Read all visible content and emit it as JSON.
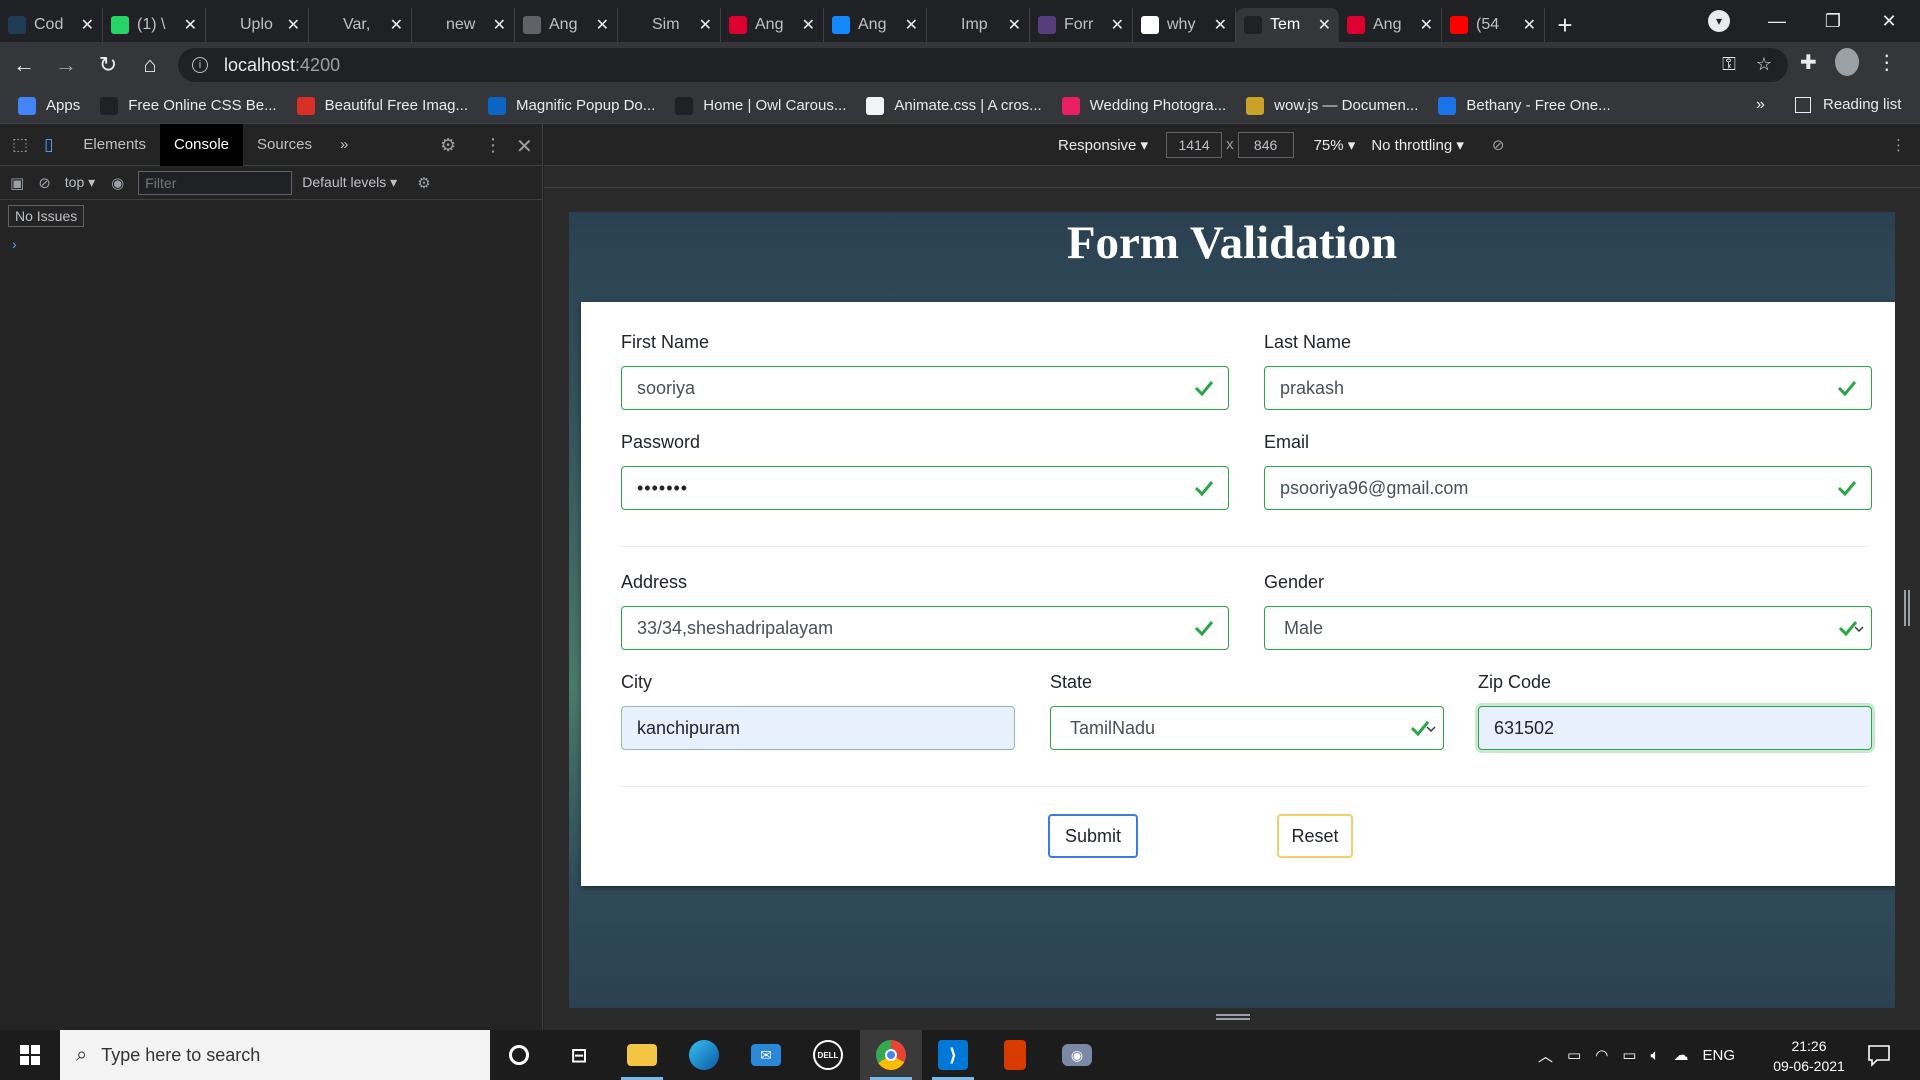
{
  "browser": {
    "tabs": [
      {
        "title": "Cod",
        "icon": "vscode-doc-icon",
        "color": "#1f3b57"
      },
      {
        "title": "(1) \\",
        "icon": "whatsapp-icon",
        "color": "#25d366"
      },
      {
        "title": "Uplo",
        "icon": "github-icon",
        "color": "#202124"
      },
      {
        "title": "Var,",
        "icon": "angular-a-icon",
        "color": "#202124"
      },
      {
        "title": "new",
        "icon": "dev-icon",
        "color": "#202124"
      },
      {
        "title": "Ang",
        "icon": "photo-icon",
        "color": "#5f6368"
      },
      {
        "title": "Sim",
        "icon": "openai-icon",
        "color": "#202124"
      },
      {
        "title": "Ang",
        "icon": "angular-icon",
        "color": "#dd0031"
      },
      {
        "title": "Ang",
        "icon": "bolt-icon",
        "color": "#1389fd"
      },
      {
        "title": "Imp",
        "icon": "medium-icon",
        "color": "#202124"
      },
      {
        "title": "Forr",
        "icon": "bootstrap-icon",
        "color": "#563d7c"
      },
      {
        "title": "why",
        "icon": "google-icon",
        "color": "#ffffff"
      },
      {
        "title": "Tem",
        "icon": "angular-tab-icon",
        "color": "#202124"
      },
      {
        "title": "Ang",
        "icon": "angular-icon",
        "color": "#dd0031"
      },
      {
        "title": "(54",
        "icon": "youtube-icon",
        "color": "#ff0000"
      }
    ],
    "url_host": "localhost",
    "url_port": ":4200",
    "bookmarks": [
      {
        "label": "Apps",
        "icon": "apps-grid-icon",
        "color": "#4285f4"
      },
      {
        "label": "Free Online CSS Be...",
        "icon": "ff-icon",
        "color": "#202124"
      },
      {
        "label": "Beautiful Free Imag...",
        "icon": "images-icon",
        "color": "#d93025"
      },
      {
        "label": "Magnific Popup Do...",
        "icon": "linkedin-icon",
        "color": "#0a66c2"
      },
      {
        "label": "Home | Owl Carous...",
        "icon": "owl-icon",
        "color": "#202124"
      },
      {
        "label": "Animate.css | A cros...",
        "icon": "animate-icon",
        "color": "#f1f3f4"
      },
      {
        "label": "Wedding Photogra...",
        "icon": "wedding-icon",
        "color": "#e91e63"
      },
      {
        "label": "wow.js — Documen...",
        "icon": "wowjs-icon",
        "color": "#c9a227"
      },
      {
        "label": "Bethany - Free One...",
        "icon": "bethany-icon",
        "color": "#1a73e8"
      }
    ],
    "bookmarks_more": "»",
    "reading_list": "Reading list"
  },
  "devtools": {
    "tabs": [
      "Elements",
      "Console",
      "Sources"
    ],
    "active_tab": "Console",
    "more": "»",
    "context": "top",
    "filter_placeholder": "Filter",
    "levels": "Default levels",
    "issues": "No Issues",
    "prompt": "›"
  },
  "device_toolbar": {
    "mode": "Responsive",
    "width": "1414",
    "times": "x",
    "height": "846",
    "zoom": "75%",
    "throttling": "No throttling"
  },
  "form": {
    "title": "Form Validation",
    "first_name": {
      "label": "First Name",
      "value": "sooriya"
    },
    "last_name": {
      "label": "Last Name",
      "value": "prakash"
    },
    "password": {
      "label": "Password",
      "value": "•••••••"
    },
    "email": {
      "label": "Email",
      "value": "psooriya96@gmail.com"
    },
    "address": {
      "label": "Address",
      "value": "33/34,sheshadripalayam"
    },
    "gender": {
      "label": "Gender",
      "value": "Male"
    },
    "city": {
      "label": "City",
      "value": "kanchipuram"
    },
    "state": {
      "label": "State",
      "value": "TamilNadu"
    },
    "zip": {
      "label": "Zip Code",
      "value": "631502"
    },
    "submit_label": "Submit",
    "reset_label": "Reset",
    "valid_color": "#28a745"
  },
  "taskbar": {
    "search_placeholder": "Type here to search",
    "apps": [
      "cortana-icon",
      "task-view-icon",
      "file-explorer-icon",
      "edge-icon",
      "mail-icon",
      "dell-icon",
      "chrome-icon",
      "vscode-icon",
      "office-icon",
      "camera-icon"
    ],
    "language": "ENG",
    "time": "21:26",
    "date": "09-06-2021"
  }
}
